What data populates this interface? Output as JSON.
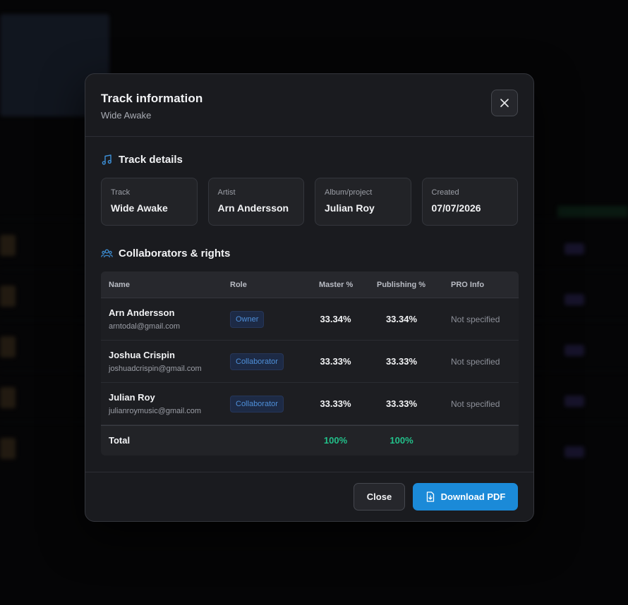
{
  "modal": {
    "title": "Track information",
    "subtitle": "Wide Awake",
    "close_icon": "close-icon"
  },
  "track_details": {
    "heading": "Track details",
    "icon": "music-note-icon",
    "cards": [
      {
        "label": "Track",
        "value": "Wide Awake"
      },
      {
        "label": "Artist",
        "value": "Arn Andersson"
      },
      {
        "label": "Album/project",
        "value": "Julian Roy"
      },
      {
        "label": "Created",
        "value": "07/07/2026"
      }
    ]
  },
  "collaborators": {
    "heading": "Collaborators & rights",
    "icon": "users-icon",
    "columns": [
      "Name",
      "Role",
      "Master %",
      "Publishing %",
      "PRO Info"
    ],
    "rows": [
      {
        "name": "Arn Andersson",
        "email": "arntodal@gmail.com",
        "role": "Owner",
        "master": "33.34%",
        "publishing": "33.34%",
        "pro": "Not specified"
      },
      {
        "name": "Joshua Crispin",
        "email": "joshuadcrispin@gmail.com",
        "role": "Collaborator",
        "master": "33.33%",
        "publishing": "33.33%",
        "pro": "Not specified"
      },
      {
        "name": "Julian Roy",
        "email": "julianroymusic@gmail.com",
        "role": "Collaborator",
        "master": "33.33%",
        "publishing": "33.33%",
        "pro": "Not specified"
      }
    ],
    "total": {
      "label": "Total",
      "master": "100%",
      "publishing": "100%"
    }
  },
  "footer": {
    "close_label": "Close",
    "download_label": "Download PDF",
    "download_icon": "file-download-icon"
  },
  "colors": {
    "accent": "#1b8ad8",
    "success": "#22c08a",
    "role_badge_text": "#4e8fd9",
    "modal_bg": "#1a1b1f"
  }
}
